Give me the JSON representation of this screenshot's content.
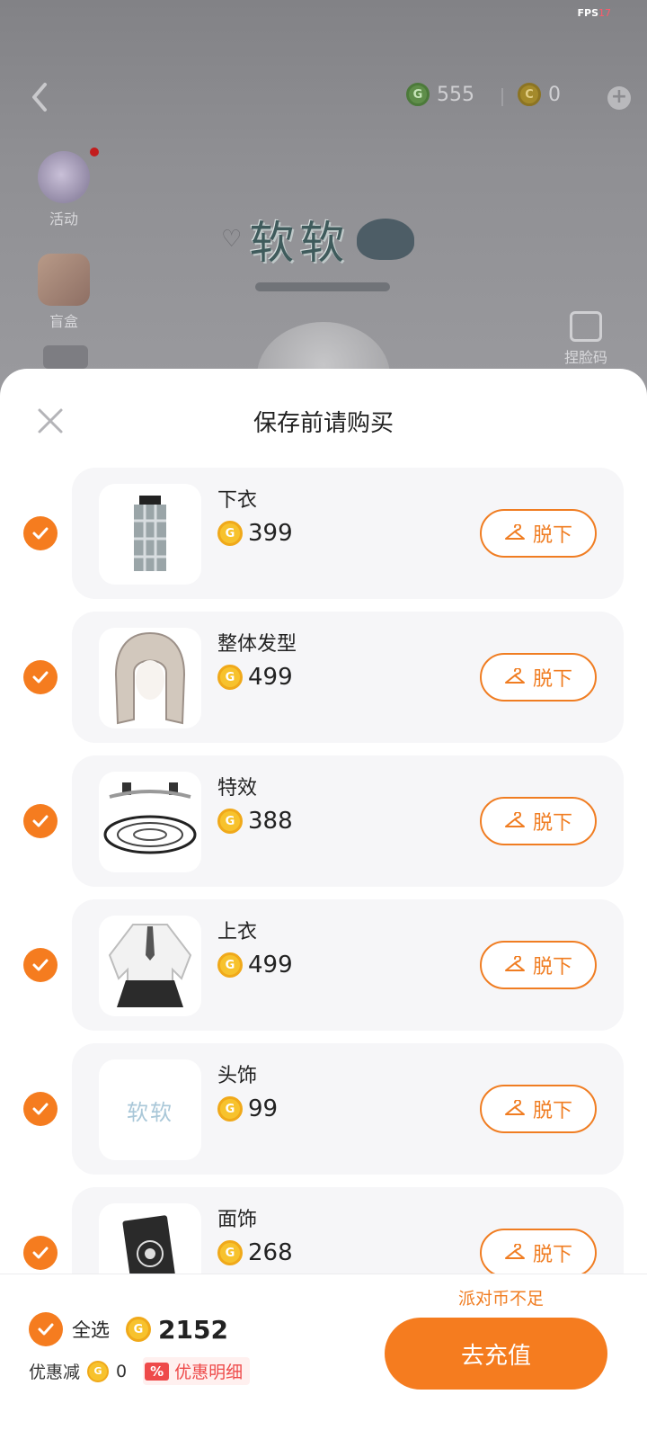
{
  "status": {
    "fps_label": "FPS",
    "fps_value": "17"
  },
  "header": {
    "green_currency": "555",
    "gold_currency": "0",
    "green_coin_symbol": "G",
    "gold_coin_symbol": "C",
    "plus_symbol": "+"
  },
  "side": {
    "activity_label": "活动",
    "blind_box_label": "盲盒",
    "face_code_label": "捏脸码"
  },
  "avatar": {
    "name_tag": "软软"
  },
  "sheet": {
    "title": "保存前请购买"
  },
  "coin_symbol": "G",
  "items": [
    {
      "name": "下衣",
      "price": "399",
      "action": "脱下"
    },
    {
      "name": "整体发型",
      "price": "499",
      "action": "脱下"
    },
    {
      "name": "特效",
      "price": "388",
      "action": "脱下"
    },
    {
      "name": "上衣",
      "price": "499",
      "action": "脱下"
    },
    {
      "name": "头饰",
      "price": "99",
      "action": "脱下",
      "thumb_text": "软软"
    },
    {
      "name": "面饰",
      "price": "268",
      "action": "脱下"
    }
  ],
  "footer": {
    "warning": "派对币不足",
    "select_all_label": "全选",
    "total": "2152",
    "discount_label": "优惠减",
    "discount_value": "0",
    "percent_badge": "%",
    "discount_detail_label": "优惠明细",
    "recharge_label": "去充值"
  },
  "colors": {
    "accent": "#f57c1f",
    "coin": "#f7c22d",
    "detail_red": "#ee4a4a"
  }
}
